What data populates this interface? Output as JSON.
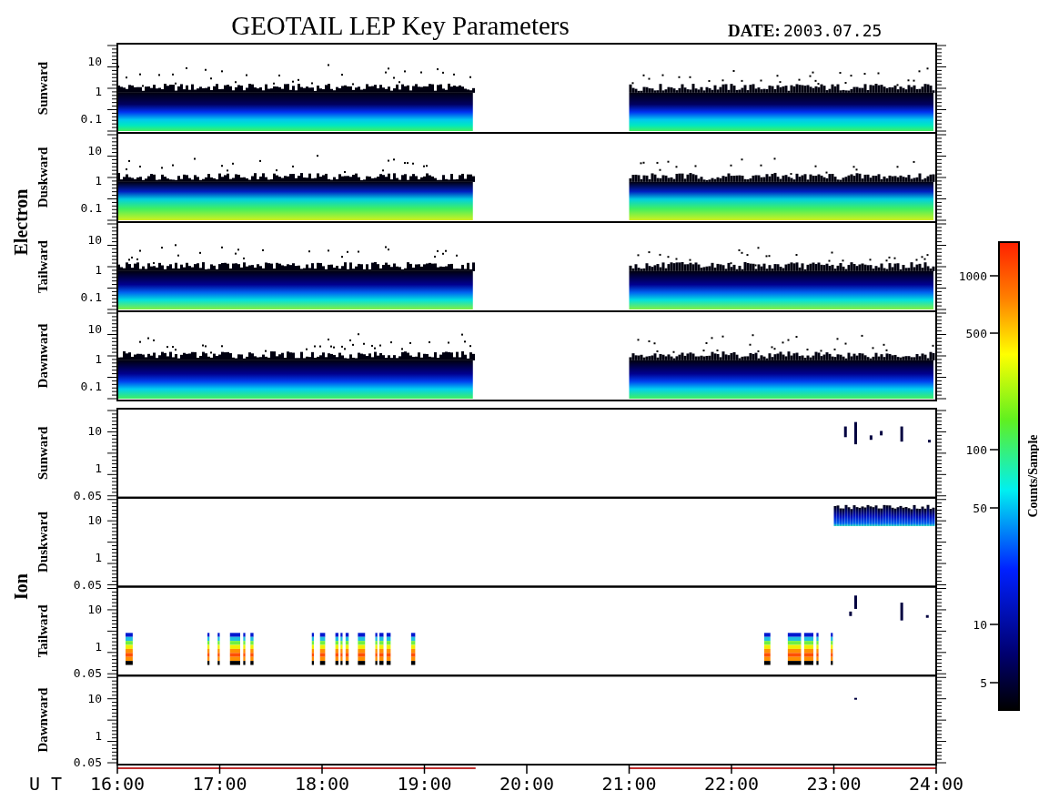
{
  "title": "GEOTAIL LEP Key Parameters",
  "date_label": "DATE:",
  "date": "2003.07.25",
  "groups": [
    {
      "species": "Electron",
      "kind": "electron",
      "panels": [
        {
          "direction": "Sunward",
          "yticks": [
            "10",
            "1",
            "0.1"
          ]
        },
        {
          "direction": "Duskward",
          "yticks": [
            "10",
            "1",
            "0.1"
          ]
        },
        {
          "direction": "Tailward",
          "yticks": [
            "10",
            "1",
            "0.1"
          ]
        },
        {
          "direction": "Dawnward",
          "yticks": [
            "10",
            "1",
            "0.1"
          ]
        }
      ]
    },
    {
      "species": "Ion",
      "kind": "ion",
      "panels": [
        {
          "direction": "Sunward",
          "yticks": [
            "10",
            "1",
            "0.05"
          ]
        },
        {
          "direction": "Duskward",
          "yticks": [
            "10",
            "1",
            "0.05"
          ]
        },
        {
          "direction": "Tailward",
          "yticks": [
            "10",
            "1",
            "0.05"
          ]
        },
        {
          "direction": "Dawnward",
          "yticks": [
            "10",
            "1",
            "0.05"
          ]
        }
      ]
    }
  ],
  "time_axis": {
    "label": "U T",
    "ticks": [
      "16:00",
      "17:00",
      "18:00",
      "19:00",
      "20:00",
      "21:00",
      "22:00",
      "23:00",
      "24:00"
    ]
  },
  "colorbar": {
    "title": "Counts/Sample",
    "ticks": [
      "1000",
      "500",
      "100",
      "50",
      "10",
      "5"
    ]
  }
}
